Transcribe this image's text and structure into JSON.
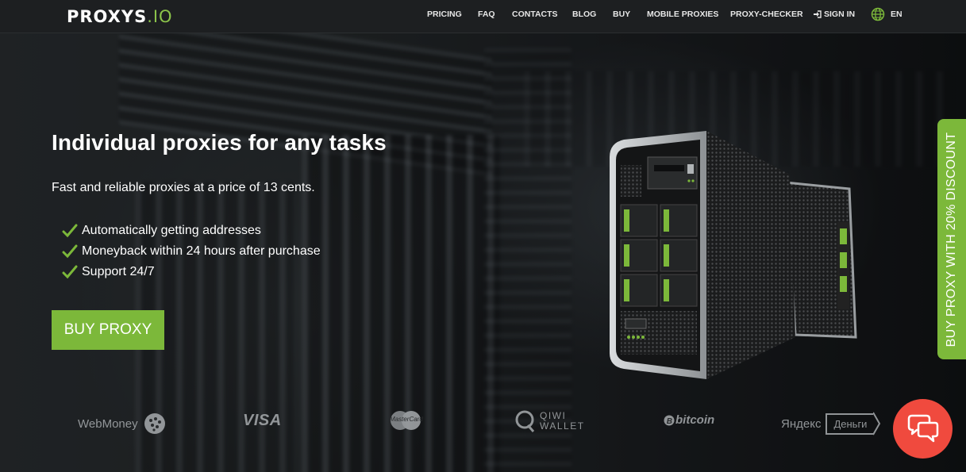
{
  "header": {
    "logo": {
      "part_a": "PROXYS",
      "part_b": ".IO"
    },
    "nav": [
      {
        "label": "PRICING"
      },
      {
        "label": "FAQ"
      },
      {
        "label": "CONTACTS"
      },
      {
        "label": "BLOG"
      },
      {
        "label": "BUY"
      },
      {
        "label": "MOBILE PROXIES"
      },
      {
        "label": "PROXY-CHECKER"
      }
    ],
    "sign_in": "SIGN IN",
    "language": "EN"
  },
  "hero": {
    "title": "Individual proxies for any tasks",
    "subtitle": "Fast and reliable proxies at a price of 13 cents.",
    "features": [
      "Automatically getting addresses",
      "Moneyback within 24 hours after purchase",
      "Support 24/7"
    ],
    "cta": "BUY PROXY"
  },
  "side_tab": {
    "label": "BUY PROXY WITH 20% DISCOUNT"
  },
  "payments": {
    "webmoney": "WebMoney",
    "visa": "VISA",
    "mastercard": "MasterCard",
    "qiwi_line1": "QIWI",
    "qiwi_line2": "WALLET",
    "bitcoin": "bitcoin",
    "yandex": "Яндекс",
    "dengi": "Деньги"
  },
  "icons": {
    "sign_in": "sign-in-icon",
    "language": "globe-icon",
    "feature_check": "check-icon",
    "chat": "chat-bubbles-icon"
  },
  "colors": {
    "accent": "#7cb83a",
    "chat": "#f04a3e",
    "header_bg": "#1d1f21"
  }
}
